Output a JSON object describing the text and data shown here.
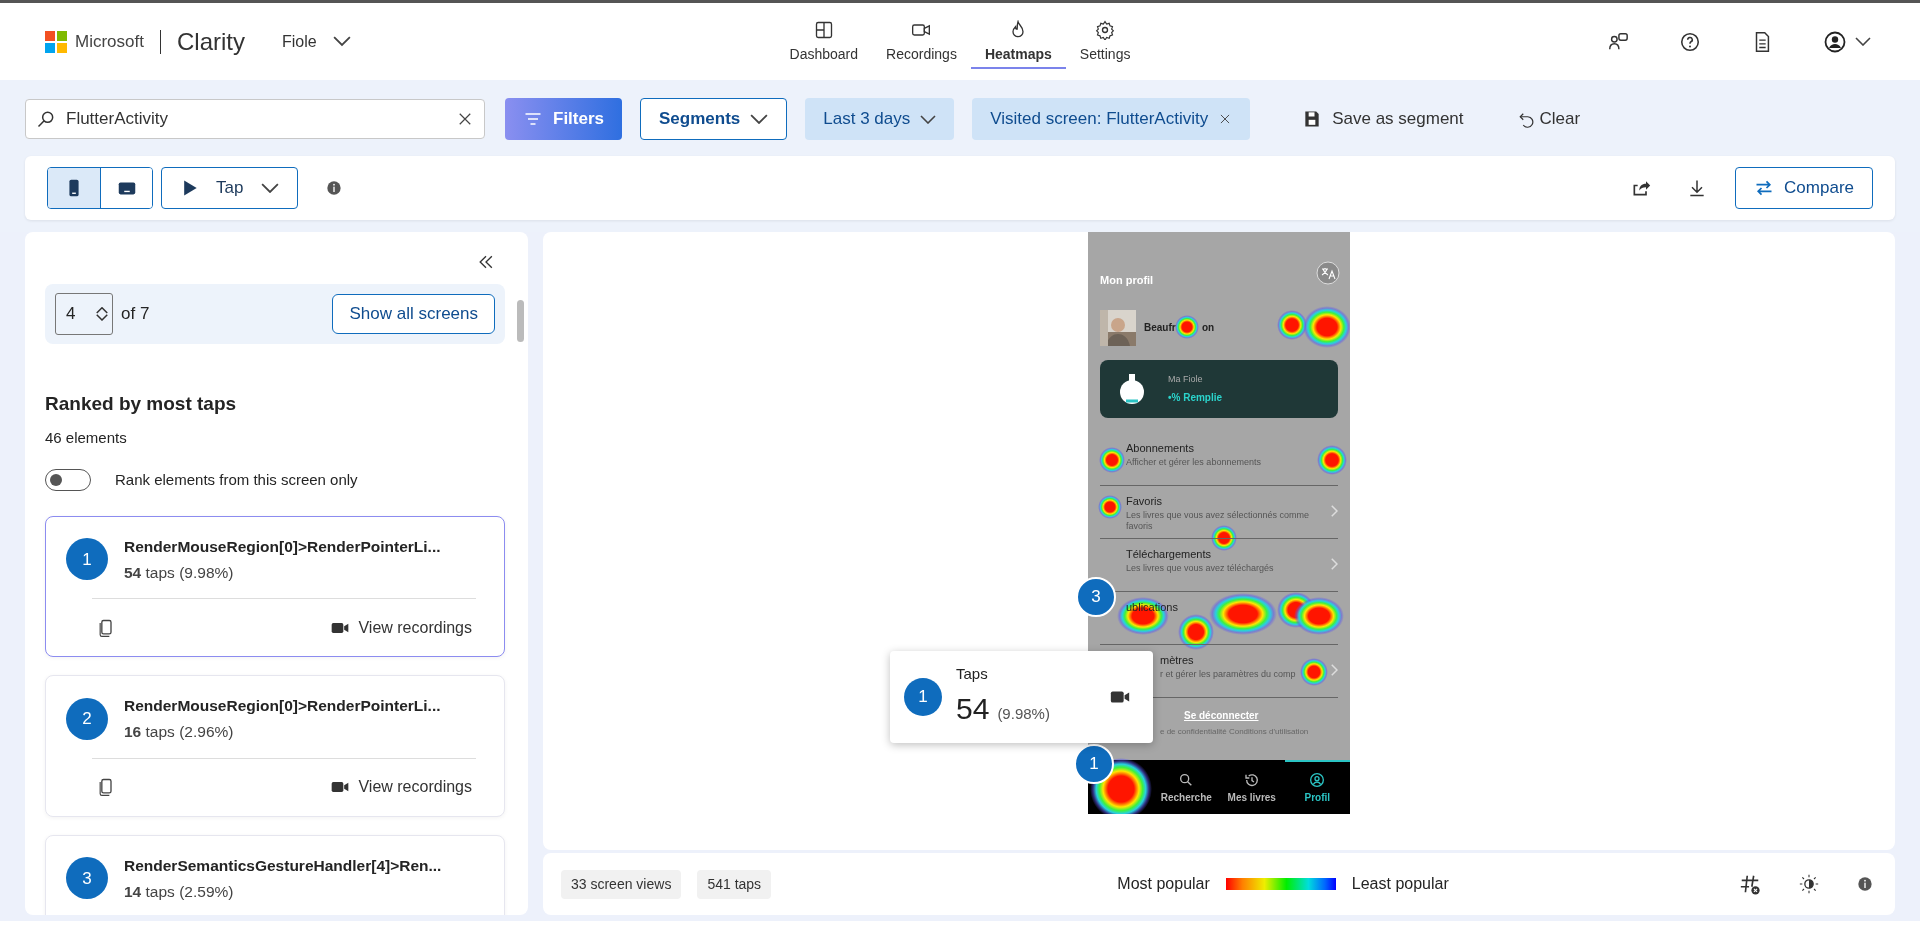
{
  "header": {
    "brand": "Microsoft",
    "product": "Clarity",
    "project": "Fiole",
    "nav": [
      {
        "label": "Dashboard",
        "selected": false
      },
      {
        "label": "Recordings",
        "selected": false
      },
      {
        "label": "Heatmaps",
        "selected": true
      },
      {
        "label": "Settings",
        "selected": false
      }
    ]
  },
  "filters": {
    "search": {
      "value": "FlutterActivity"
    },
    "filters_button": "Filters",
    "segments": "Segments",
    "date": "Last 3 days",
    "chips": [
      {
        "label": "Visited screen: FlutterActivity"
      }
    ],
    "save": "Save as segment",
    "clear": "Clear"
  },
  "toolbar": {
    "devices": [
      {
        "kind": "mobile",
        "selected": true
      },
      {
        "kind": "desktop",
        "selected": false
      }
    ],
    "mode": "Tap",
    "compare": "Compare"
  },
  "sidebar": {
    "screen_index": "4",
    "screen_total": "of 7",
    "show_all": "Show all screens",
    "heading": "Ranked by most taps",
    "count": "46 elements",
    "toggle": {
      "label": "Rank elements from this screen only",
      "on": false
    },
    "elements": [
      {
        "rank": "1",
        "name": "RenderMouseRegion[0]>RenderPointerLi...",
        "taps": "54",
        "unit": "taps",
        "percent": "(9.98%)",
        "selected": true,
        "action": "View recordings"
      },
      {
        "rank": "2",
        "name": "RenderMouseRegion[0]>RenderPointerLi...",
        "taps": "16",
        "unit": "taps",
        "percent": "(2.96%)",
        "selected": false,
        "action": "View recordings"
      },
      {
        "rank": "3",
        "name": "RenderSemanticsGestureHandler[4]>Ren...",
        "taps": "14",
        "unit": "taps",
        "percent": "(2.59%)",
        "selected": false
      }
    ]
  },
  "heatmap": {
    "phone": {
      "title": "Mon profil",
      "user": [
        "Beaufr",
        "on"
      ],
      "card": {
        "title": "Ma Fiole",
        "subtitle": "•% Remplie"
      },
      "rows": [
        {
          "kind": "plain",
          "title": "Abonnements",
          "subtitle": "Afficher et gérer les abonnements"
        },
        {
          "kind": "link",
          "title": "Favoris",
          "subtitle": "Les livres que vous avez sélectionnés comme favoris"
        },
        {
          "kind": "download",
          "title": "Téléchargements",
          "subtitle": "Les livres que vous avez téléchargés"
        },
        {
          "kind": "plain",
          "title": "ublications"
        },
        {
          "kind": "cut",
          "title": "mètres",
          "subtitle": "r et gérer les paramètres du comp"
        }
      ],
      "logout": "Se déconnecter",
      "legal": "e de confidentialité Conditions d'utilisation",
      "tabs": [
        {
          "label": "Recherche",
          "selected": false
        },
        {
          "label": "Mes livres",
          "selected": false
        },
        {
          "label": "Profil",
          "selected": true
        }
      ]
    },
    "markers": [
      {
        "rank": "3"
      },
      {
        "rank": "1"
      }
    ],
    "tooltip": {
      "rank": "1",
      "label": "Taps",
      "value": "54",
      "percent": "(9.98%)"
    }
  },
  "footer": {
    "stats": [
      "33 screen views",
      "541 taps"
    ],
    "legend_high": "Most popular",
    "legend_low": "Least popular"
  }
}
